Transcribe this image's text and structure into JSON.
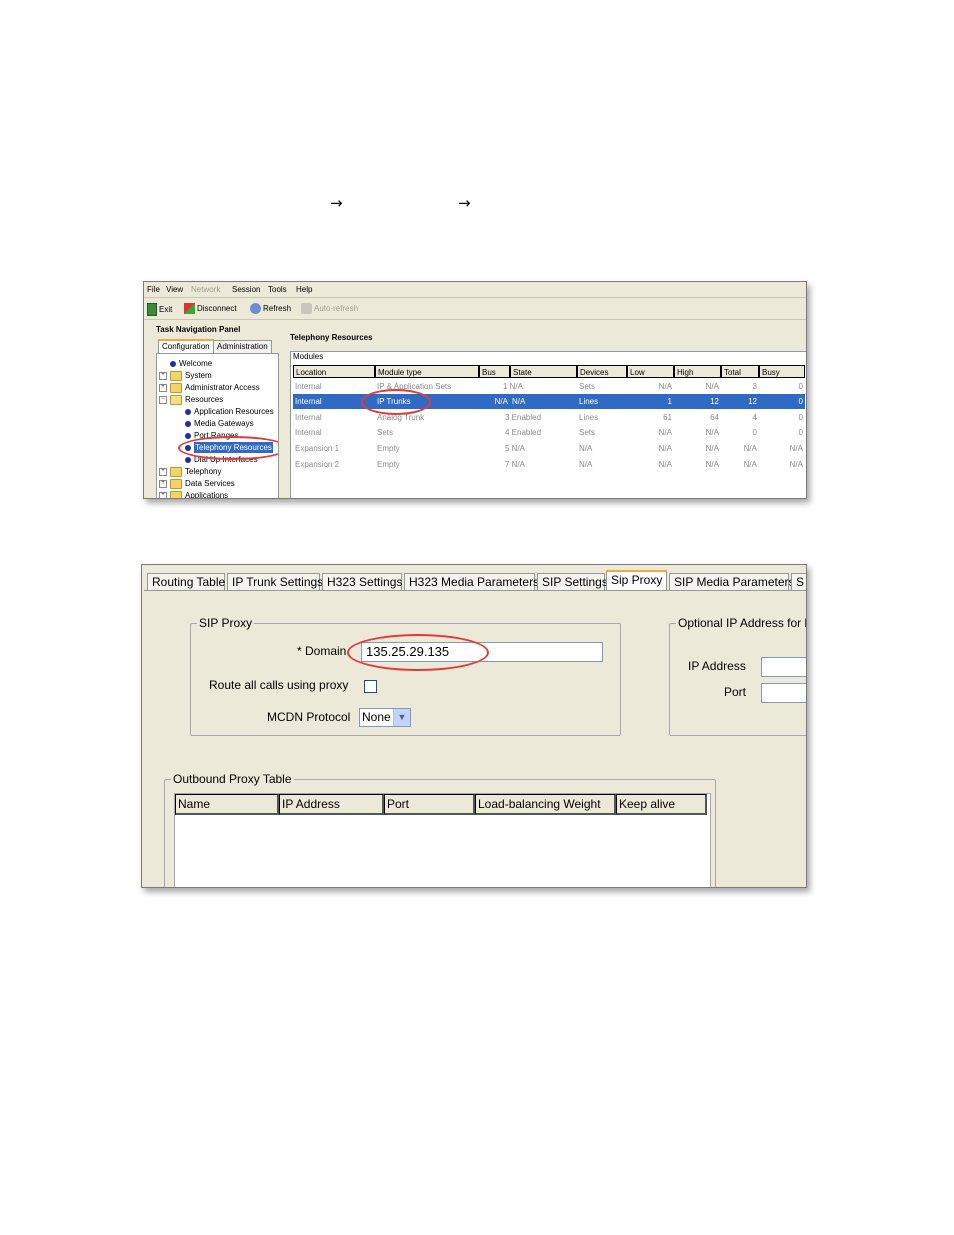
{
  "navigation_path": {
    "separator": "→",
    "separator_count": 2
  },
  "screenshot1": {
    "menu": [
      "File",
      "View",
      "Network",
      "Session",
      "Tools",
      "Help"
    ],
    "menu_disabled": [
      "Network"
    ],
    "toolbar": {
      "exit": "Exit",
      "disconnect": "Disconnect",
      "refresh": "Refresh",
      "auto_refresh": "Auto-refresh"
    },
    "nav_panel": {
      "title": "Task Navigation Panel",
      "tabs": [
        "Configuration",
        "Administration"
      ],
      "tree": [
        {
          "label": "Welcome",
          "type": "leaf",
          "level": 1
        },
        {
          "label": "System",
          "type": "folder",
          "level": 0
        },
        {
          "label": "Administrator Access",
          "type": "folder",
          "level": 0
        },
        {
          "label": "Resources",
          "type": "folder-open",
          "level": 0
        },
        {
          "label": "Application Resources",
          "type": "leaf",
          "level": 2
        },
        {
          "label": "Media Gateways",
          "type": "leaf",
          "level": 2
        },
        {
          "label": "Port Ranges",
          "type": "leaf",
          "level": 2
        },
        {
          "label": "Telephony Resources",
          "type": "leaf",
          "level": 2,
          "selected": true
        },
        {
          "label": "Dial Up Interfaces",
          "type": "leaf",
          "level": 2
        },
        {
          "label": "Telephony",
          "type": "folder",
          "level": 0
        },
        {
          "label": "Data Services",
          "type": "folder",
          "level": 0
        },
        {
          "label": "Applications",
          "type": "folder",
          "level": 0
        }
      ]
    },
    "main": {
      "title": "Telephony Resources",
      "modules_label": "Modules",
      "columns": [
        "Location",
        "Module type",
        "Bus",
        "State",
        "Devices",
        "Low",
        "High",
        "Total",
        "Busy"
      ],
      "rows": [
        [
          "Internal",
          "IP & Application Sets",
          "",
          "1 N/A",
          "Sets",
          "N/A",
          "N/A",
          "3",
          "0"
        ],
        [
          "Internal",
          "IP Trunks",
          "N/A",
          "N/A",
          "Lines",
          "1",
          "12",
          "12",
          "0"
        ],
        [
          "Internal",
          "Analog Trunk",
          "",
          "3 Enabled",
          "Lines",
          "61",
          "64",
          "4",
          "0"
        ],
        [
          "Internal",
          "Sets",
          "",
          "4 Enabled",
          "Sets",
          "N/A",
          "N/A",
          "0",
          "0"
        ],
        [
          "Expansion 1",
          "Empty",
          "",
          "5 N/A",
          "N/A",
          "N/A",
          "N/A",
          "N/A",
          "N/A"
        ],
        [
          "Expansion 2",
          "Empty",
          "",
          "7 N/A",
          "N/A",
          "N/A",
          "N/A",
          "N/A",
          "N/A"
        ]
      ],
      "selected_row": 1
    }
  },
  "screenshot2": {
    "tabs": [
      "Routing Table",
      "IP Trunk Settings",
      "H323 Settings",
      "H323 Media Parameters",
      "SIP Settings",
      "Sip Proxy",
      "SIP Media Parameters",
      "S"
    ],
    "active_tab": "Sip Proxy",
    "sip_proxy": {
      "group_title": "SIP Proxy",
      "domain_label": "* Domain",
      "domain_value": "135.25.29.135",
      "route_all_label": "Route all calls using proxy",
      "route_all_checked": false,
      "mcdn_label": "MCDN Protocol",
      "mcdn_value": "None"
    },
    "optional_ip": {
      "group_title": "Optional IP Address for lo",
      "ip_label": "IP Address",
      "port_label": "Port"
    },
    "outbound_proxy_table": {
      "title": "Outbound Proxy Table",
      "columns": [
        "Name",
        "IP Address",
        "Port",
        "Load-balancing Weight",
        "Keep alive"
      ]
    }
  }
}
